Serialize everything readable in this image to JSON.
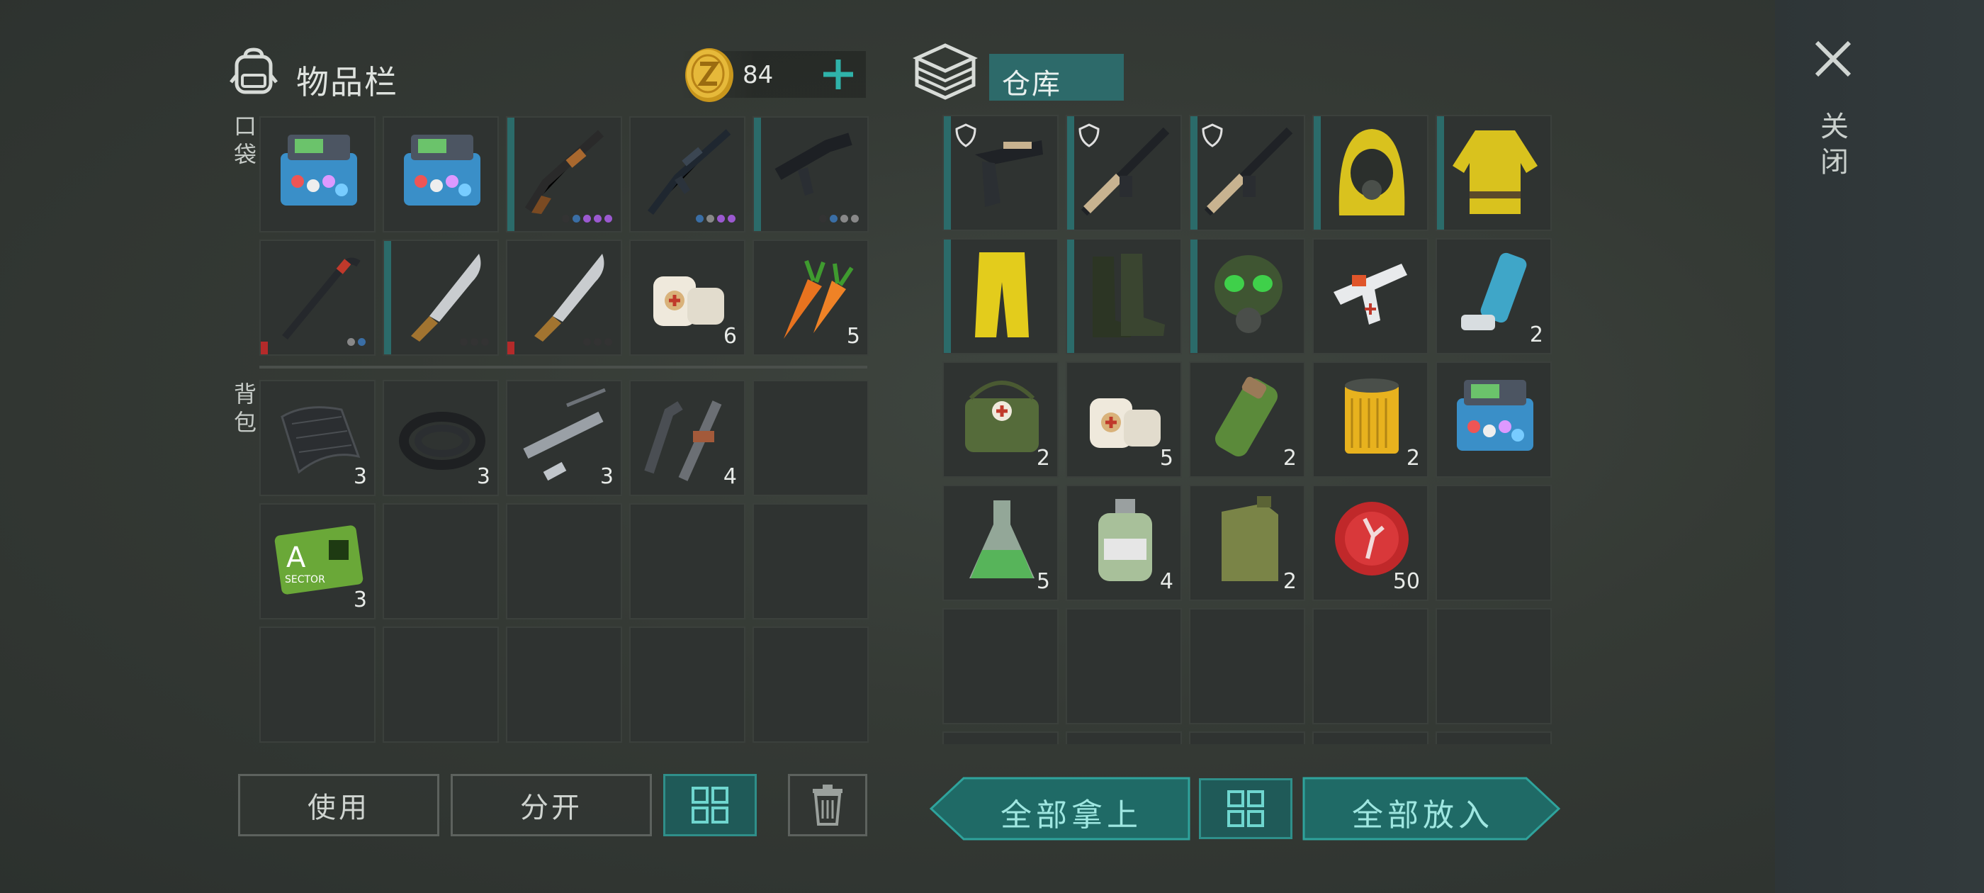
{
  "inventory": {
    "title": "物品栏",
    "coins": "84"
  },
  "storage": {
    "title": "仓库"
  },
  "close": {
    "label": "关闭"
  },
  "labels": {
    "pocket": "口袋",
    "backpack": "背包"
  },
  "buttons": {
    "use": "使用",
    "split": "分开",
    "take_all": "全部拿上",
    "put_all": "全部放入"
  },
  "colors": {
    "accent": "#2b8a86",
    "accent_dark": "#1f5a58",
    "cell": "#2f3331",
    "durability_red": "#b42a2a"
  },
  "pockets": [
    {
      "icon": "seed-box-icon",
      "count": ""
    },
    {
      "icon": "seed-box-icon",
      "count": ""
    },
    {
      "icon": "shotgun-icon",
      "count": ""
    },
    {
      "icon": "assault-rifle-icon",
      "count": ""
    },
    {
      "icon": "smg-icon",
      "count": ""
    },
    {
      "icon": "crowbar-icon",
      "count": ""
    },
    {
      "icon": "machete-icon",
      "count": ""
    },
    {
      "icon": "machete-icon",
      "count": ""
    },
    {
      "icon": "bandage-icon",
      "count": "6"
    },
    {
      "icon": "carrot-icon",
      "count": "5"
    }
  ],
  "backpack": [
    {
      "icon": "fabric-icon",
      "count": "3"
    },
    {
      "icon": "rubber-hose-icon",
      "count": "3"
    },
    {
      "icon": "pipe-parts-icon",
      "count": "3"
    },
    {
      "icon": "pipe-fittings-icon",
      "count": "4"
    },
    {
      "icon": "",
      "count": ""
    },
    {
      "icon": "sector-a-keycard-icon",
      "count": "3"
    },
    {
      "icon": "",
      "count": ""
    },
    {
      "icon": "",
      "count": ""
    },
    {
      "icon": "",
      "count": ""
    },
    {
      "icon": "",
      "count": ""
    },
    {
      "icon": "",
      "count": ""
    },
    {
      "icon": "",
      "count": ""
    },
    {
      "icon": "",
      "count": ""
    },
    {
      "icon": "",
      "count": ""
    },
    {
      "icon": "",
      "count": ""
    }
  ],
  "storage_items": [
    {
      "icon": "pistol-icon",
      "count": ""
    },
    {
      "icon": "rifle-icon",
      "count": ""
    },
    {
      "icon": "rifle-icon",
      "count": ""
    },
    {
      "icon": "hazmat-hood-icon",
      "count": ""
    },
    {
      "icon": "hazmat-jacket-icon",
      "count": ""
    },
    {
      "icon": "hazmat-pants-icon",
      "count": ""
    },
    {
      "icon": "rubber-boots-icon",
      "count": ""
    },
    {
      "icon": "gas-mask-icon",
      "count": ""
    },
    {
      "icon": "injector-gun-icon",
      "count": ""
    },
    {
      "icon": "inhaler-icon",
      "count": "2"
    },
    {
      "icon": "first-aid-bag-icon",
      "count": "2"
    },
    {
      "icon": "bandage-icon",
      "count": "5"
    },
    {
      "icon": "filter-canister-icon",
      "count": "2"
    },
    {
      "icon": "air-filter-icon",
      "count": "2"
    },
    {
      "icon": "seed-box-icon",
      "count": ""
    },
    {
      "icon": "green-flask-icon",
      "count": "5"
    },
    {
      "icon": "chemical-bottle-icon",
      "count": "4"
    },
    {
      "icon": "jerrycan-icon",
      "count": "2"
    },
    {
      "icon": "bottle-cap-icon",
      "count": "50"
    },
    {
      "icon": "",
      "count": ""
    },
    {
      "icon": "",
      "count": ""
    },
    {
      "icon": "",
      "count": ""
    },
    {
      "icon": "",
      "count": ""
    },
    {
      "icon": "",
      "count": ""
    },
    {
      "icon": "",
      "count": ""
    }
  ]
}
